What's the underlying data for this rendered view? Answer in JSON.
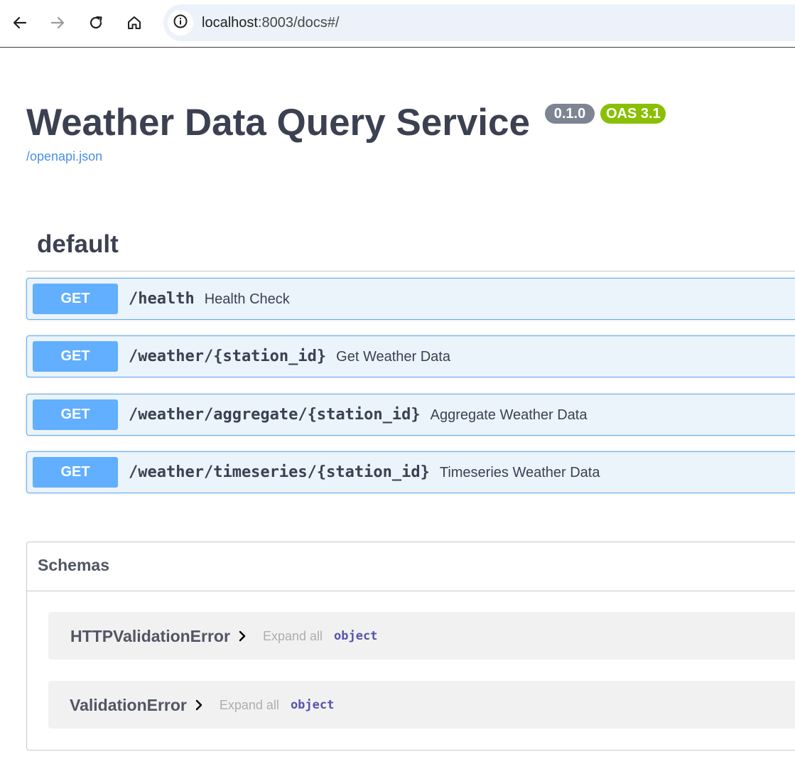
{
  "browser": {
    "url_host": "localhost",
    "url_rest": ":8003/docs#/",
    "icons": [
      "back-arrow-icon",
      "forward-arrow-icon",
      "reload-icon",
      "home-icon",
      "site-info-icon"
    ]
  },
  "info": {
    "title": "Weather Data Query Service",
    "version": "0.1.0",
    "oas": "OAS 3.1",
    "spec_link": "/openapi.json"
  },
  "tag": {
    "name": "default"
  },
  "operations": [
    {
      "method": "GET",
      "path": "/health",
      "summary": "Health Check"
    },
    {
      "method": "GET",
      "path": "/weather/{station_id}",
      "summary": "Get Weather Data"
    },
    {
      "method": "GET",
      "path": "/weather/aggregate/{station_id}",
      "summary": "Aggregate Weather Data"
    },
    {
      "method": "GET",
      "path": "/weather/timeseries/{station_id}",
      "summary": "Timeseries Weather Data"
    }
  ],
  "schemas": {
    "title": "Schemas",
    "models": [
      {
        "name": "HTTPValidationError",
        "expand_label": "Expand all",
        "type": "object"
      },
      {
        "name": "ValidationError",
        "expand_label": "Expand all",
        "type": "object"
      }
    ]
  },
  "colors": {
    "get_accent": "#61affe",
    "get_background": "#ebf3fb",
    "version_badge": "#7d8492",
    "oas_badge": "#89bf04",
    "link": "#4990e2"
  }
}
